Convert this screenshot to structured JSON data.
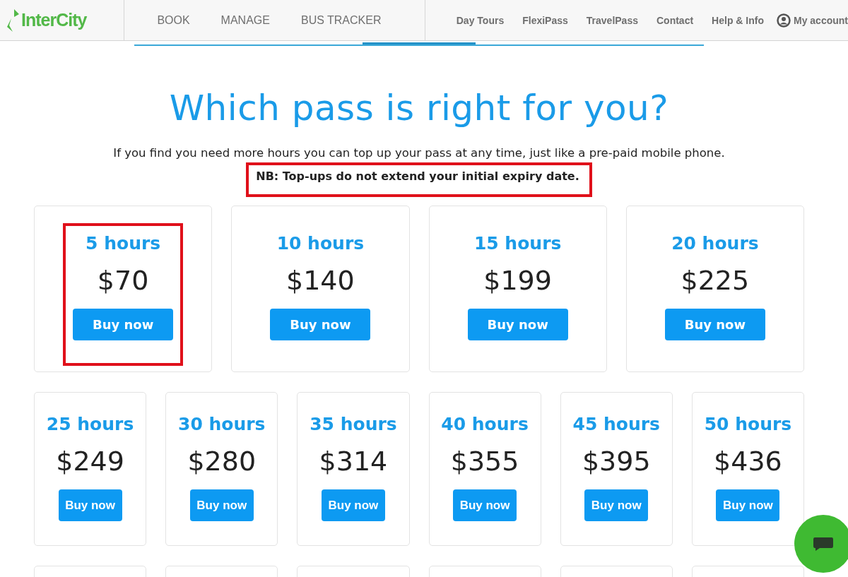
{
  "header": {
    "logo": "InterCity",
    "main_nav": [
      {
        "label": "BOOK"
      },
      {
        "label": "MANAGE"
      },
      {
        "label": "BUS TRACKER"
      }
    ],
    "secondary_nav": [
      {
        "label": "Day Tours"
      },
      {
        "label": "FlexiPass"
      },
      {
        "label": "TravelPass"
      },
      {
        "label": "Contact"
      },
      {
        "label": "Help & Info"
      }
    ],
    "account": "My account"
  },
  "title": "Which pass is right for you?",
  "intro": "If you find you need more hours you can top up your pass at any time, just like a pre-paid mobile phone.",
  "note": {
    "text": "NB: Top-ups do not extend your initial expiry date.",
    "highlighted": true
  },
  "rows": [
    {
      "passes": [
        {
          "kind": "offer",
          "hours": "5 hours",
          "price": "$70",
          "button": "Buy now",
          "highlighted": true
        },
        {
          "kind": "offer",
          "hours": "10 hours",
          "price": "$140",
          "button": "Buy now",
          "highlighted": false
        },
        {
          "kind": "offer",
          "hours": "15 hours",
          "price": "$199",
          "button": "Buy now",
          "highlighted": false
        },
        {
          "kind": "offer",
          "hours": "20 hours",
          "price": "$225",
          "button": "Buy now",
          "highlighted": false
        }
      ]
    },
    {
      "passes": [
        {
          "kind": "offer",
          "hours": "25 hours",
          "price": "$249",
          "button": "Buy now",
          "highlighted": false
        },
        {
          "kind": "offer",
          "hours": "30 hours",
          "price": "$280",
          "button": "Buy now",
          "highlighted": false
        },
        {
          "kind": "offer",
          "hours": "35 hours",
          "price": "$314",
          "button": "Buy now",
          "highlighted": false
        },
        {
          "kind": "offer",
          "hours": "40 hours",
          "price": "$355",
          "button": "Buy now",
          "highlighted": false
        },
        {
          "kind": "offer",
          "hours": "45 hours",
          "price": "$395",
          "button": "Buy now",
          "highlighted": false
        },
        {
          "kind": "offer",
          "hours": "50 hours",
          "price": "$436",
          "button": "Buy now",
          "highlighted": false
        }
      ]
    },
    {
      "passes": [
        {
          "kind": "clipped"
        },
        {
          "kind": "clipped"
        },
        {
          "kind": "clipped"
        },
        {
          "kind": "clipped"
        },
        {
          "kind": "clipped"
        },
        {
          "kind": "clipped"
        }
      ]
    }
  ]
}
